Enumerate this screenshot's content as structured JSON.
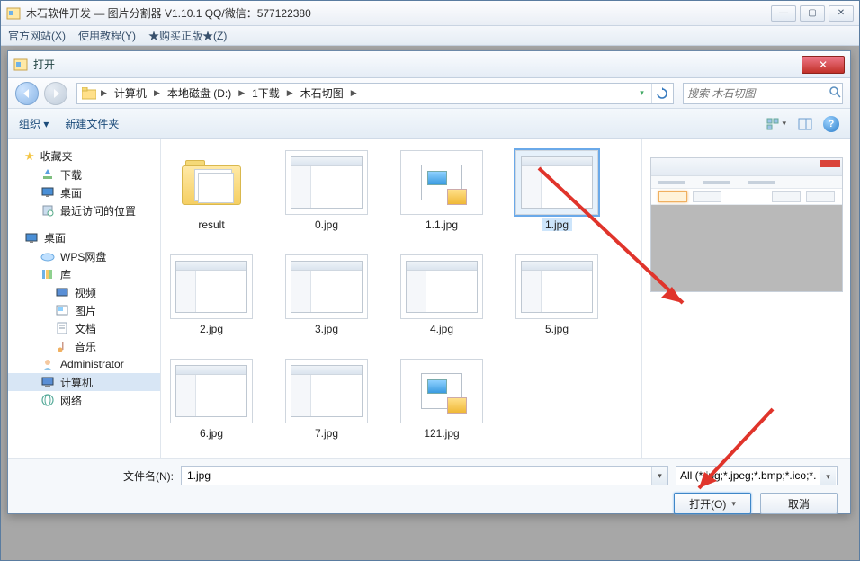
{
  "app": {
    "title": "木石软件开发 — 图片分割器 V1.10.1    QQ/微信：577122380",
    "menu": [
      "官方网站(X)",
      "使用教程(Y)",
      "★购买正版★(Z)"
    ]
  },
  "dialog": {
    "title": "打开",
    "inactive_title": "",
    "close_glyph": "✕",
    "breadcrumbs": [
      "计算机",
      "本地磁盘 (D:)",
      "1下载",
      "木石切图"
    ],
    "search_placeholder": "搜索 木石切图",
    "toolbar": {
      "organize": "组织 ▾",
      "newfolder": "新建文件夹"
    },
    "navpane": {
      "favorites": {
        "label": "收藏夹",
        "items": [
          "下载",
          "桌面",
          "最近访问的位置"
        ]
      },
      "desktop": {
        "label": "桌面",
        "items": [
          {
            "label": "WPS网盘"
          },
          {
            "label": "库",
            "children": [
              "视频",
              "图片",
              "文档",
              "音乐"
            ]
          },
          {
            "label": "Administrator"
          },
          {
            "label": "计算机",
            "selected": true
          },
          {
            "label": "网络"
          }
        ]
      }
    },
    "files": [
      {
        "name": "result",
        "kind": "folder"
      },
      {
        "name": "0.jpg",
        "kind": "app"
      },
      {
        "name": "1.1.jpg",
        "kind": "pic"
      },
      {
        "name": "1.jpg",
        "kind": "app",
        "selected": true
      },
      {
        "name": "2.jpg",
        "kind": "app"
      },
      {
        "name": "3.jpg",
        "kind": "app"
      },
      {
        "name": "4.jpg",
        "kind": "app"
      },
      {
        "name": "5.jpg",
        "kind": "app"
      },
      {
        "name": "6.jpg",
        "kind": "app"
      },
      {
        "name": "7.jpg",
        "kind": "app"
      },
      {
        "name": "121.jpg",
        "kind": "pic"
      }
    ],
    "filename_label": "文件名(N):",
    "filename_value": "1.jpg",
    "filetype_label": "All (*.jpg;*.jpeg;*.bmp;*.ico;*. ",
    "open_btn": "打开(O)",
    "cancel_btn": "取消"
  },
  "winbtns": {
    "min": "—",
    "max": "▢",
    "close": "✕"
  }
}
